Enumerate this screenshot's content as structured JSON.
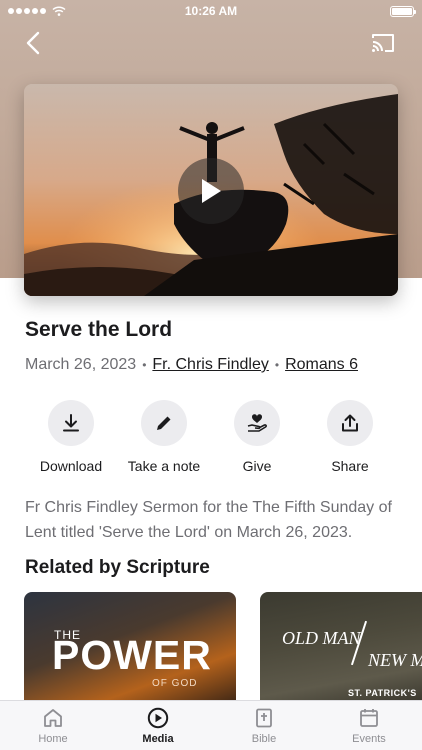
{
  "status_bar": {
    "time": "10:26 AM",
    "signal_dots": 5
  },
  "nav": {
    "back_icon": "chevron-left-icon",
    "cast_icon": "cast-icon"
  },
  "video": {
    "play_icon": "play-icon"
  },
  "sermon": {
    "title": "Serve the Lord",
    "date": "March 26, 2023",
    "speaker": "Fr. Chris Findley",
    "scripture": "Romans 6",
    "separator": "•",
    "description": "Fr Chris Findley Sermon for the The Fifth Sunday of Lent titled 'Serve the Lord' on March 26, 2023."
  },
  "actions": [
    {
      "label": "Download",
      "icon": "download-icon"
    },
    {
      "label": "Take a note",
      "icon": "pencil-icon"
    },
    {
      "label": "Give",
      "icon": "give-heart-hand-icon"
    },
    {
      "label": "Share",
      "icon": "share-icon"
    }
  ],
  "related": {
    "section_title": "Related by Scripture",
    "cards": [
      {
        "small": "THE",
        "big": "POWER",
        "sub": "OF GOD"
      },
      {
        "line1": "OLD MAN",
        "line2": "NEW M",
        "brand": "ST. PATRICK'S"
      }
    ]
  },
  "tabbar": {
    "tabs": [
      {
        "label": "Home",
        "icon": "home-icon",
        "active": false
      },
      {
        "label": "Media",
        "icon": "play-circle-icon",
        "active": true
      },
      {
        "label": "Bible",
        "icon": "bible-icon",
        "active": false
      },
      {
        "label": "Events",
        "icon": "calendar-icon",
        "active": false
      }
    ]
  },
  "colors": {
    "hero_background": "#c2aa9a",
    "text_primary": "#1c1c1e",
    "text_secondary": "#6e6e73",
    "action_circle": "#ececef",
    "tabbar_background": "#f7f7f9"
  }
}
